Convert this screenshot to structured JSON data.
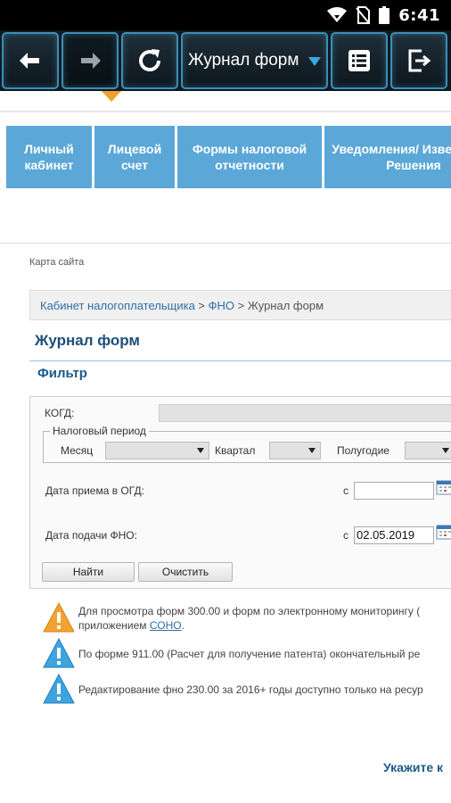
{
  "status_bar": {
    "time": "6:41",
    "icons": [
      "wifi-icon",
      "no-sim-icon",
      "battery-icon"
    ]
  },
  "toolbar": {
    "buttons": [
      "back-icon",
      "forward-icon",
      "refresh-icon",
      "list-icon",
      "exit-icon"
    ],
    "dropdown_label": "Журнал форм",
    "accent_color": "#3a8fb7",
    "indicator_color": "#f0a030"
  },
  "nav": {
    "items": [
      {
        "label": "Личный кабинет"
      },
      {
        "label": "Лицевой счет"
      },
      {
        "label": "Формы налоговой отчетности"
      },
      {
        "label": "Уведомления/ Извещения/ Решения"
      }
    ],
    "color": "#5ba7d7"
  },
  "page": {
    "sitemap": "Карта сайта",
    "breadcrumb": {
      "links": [
        "Кабинет налогоплательщика",
        "ФНО"
      ],
      "separator": " > ",
      "current": "Журнал форм"
    },
    "title": "Журнал форм",
    "filter_heading": "Фильтр"
  },
  "filter": {
    "kogd_label": "КОГД:",
    "period_legend": "Налоговый период",
    "month_label": "Месяц",
    "quarter_label": "Квартал",
    "halfyear_label": "Полугодие",
    "receive_date_label": "Дата приема в ОГД:",
    "receive_from": "с",
    "receive_value": "",
    "submit_date_label": "Дата подачи ФНО:",
    "submit_from": "с",
    "submit_value": "02.05.2019",
    "find_button": "Найти",
    "clear_button": "Очистить"
  },
  "notices": [
    {
      "icon": "warning-icon",
      "text1": "Для просмотра форм 300.00 и форм по электронному мониторингу (",
      "text2_prefix": "приложением ",
      "text2_link": "СОНО",
      "text2_suffix": "."
    },
    {
      "icon": "info-icon",
      "text1": "По форме 911.00 (Расчет для получение патента) окончательный ре"
    },
    {
      "icon": "info-icon",
      "text1": "Редактирование фно 230.00 за 2016+ годы доступно только на ресур"
    }
  ],
  "bottom_link": "Укажите к"
}
